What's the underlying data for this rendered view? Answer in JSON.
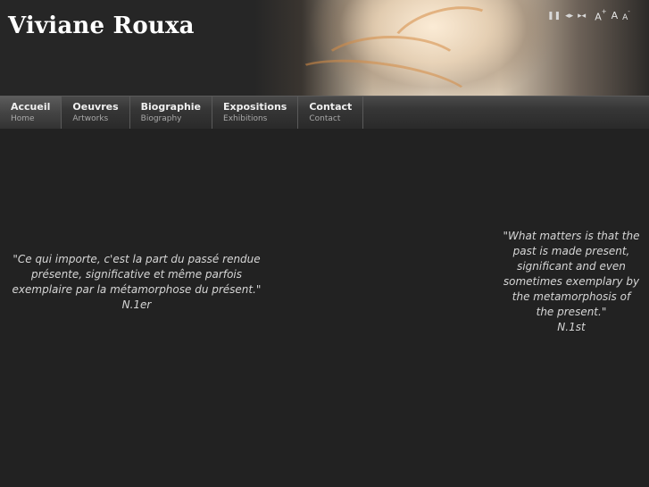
{
  "site": {
    "title": "Viviane Rouxa"
  },
  "controls": {
    "pause_icon": "pause-icon",
    "prev_next_icon": "prev-next-icon",
    "skip_icon": "skip-icon",
    "font_increase": "A",
    "font_increase_sup": "+",
    "font_normal": "A",
    "font_decrease": "A",
    "font_decrease_sup": "-"
  },
  "nav": {
    "items": [
      {
        "label": "Accueil",
        "sub": "Home"
      },
      {
        "label": "Oeuvres",
        "sub": "Artworks"
      },
      {
        "label": "Biographie",
        "sub": "Biography"
      },
      {
        "label": "Expositions",
        "sub": "Exhibitions"
      },
      {
        "label": "Contact",
        "sub": "Contact"
      }
    ]
  },
  "quotes": {
    "fr": {
      "text": "\"Ce qui importe, c'est la part du passé rendue présente, significative et même parfois exemplaire par la métamorphose du présent.\"",
      "author": "N.1er"
    },
    "en": {
      "text": "\"What matters is that the past is made present, significant and even sometimes exemplary by the metamorphosis of the present.\"",
      "author": "N.1st"
    }
  },
  "colors": {
    "background": "#222222",
    "header": "#262626",
    "text": "#dcdcdc",
    "nav_sub": "#a9a9a9"
  }
}
